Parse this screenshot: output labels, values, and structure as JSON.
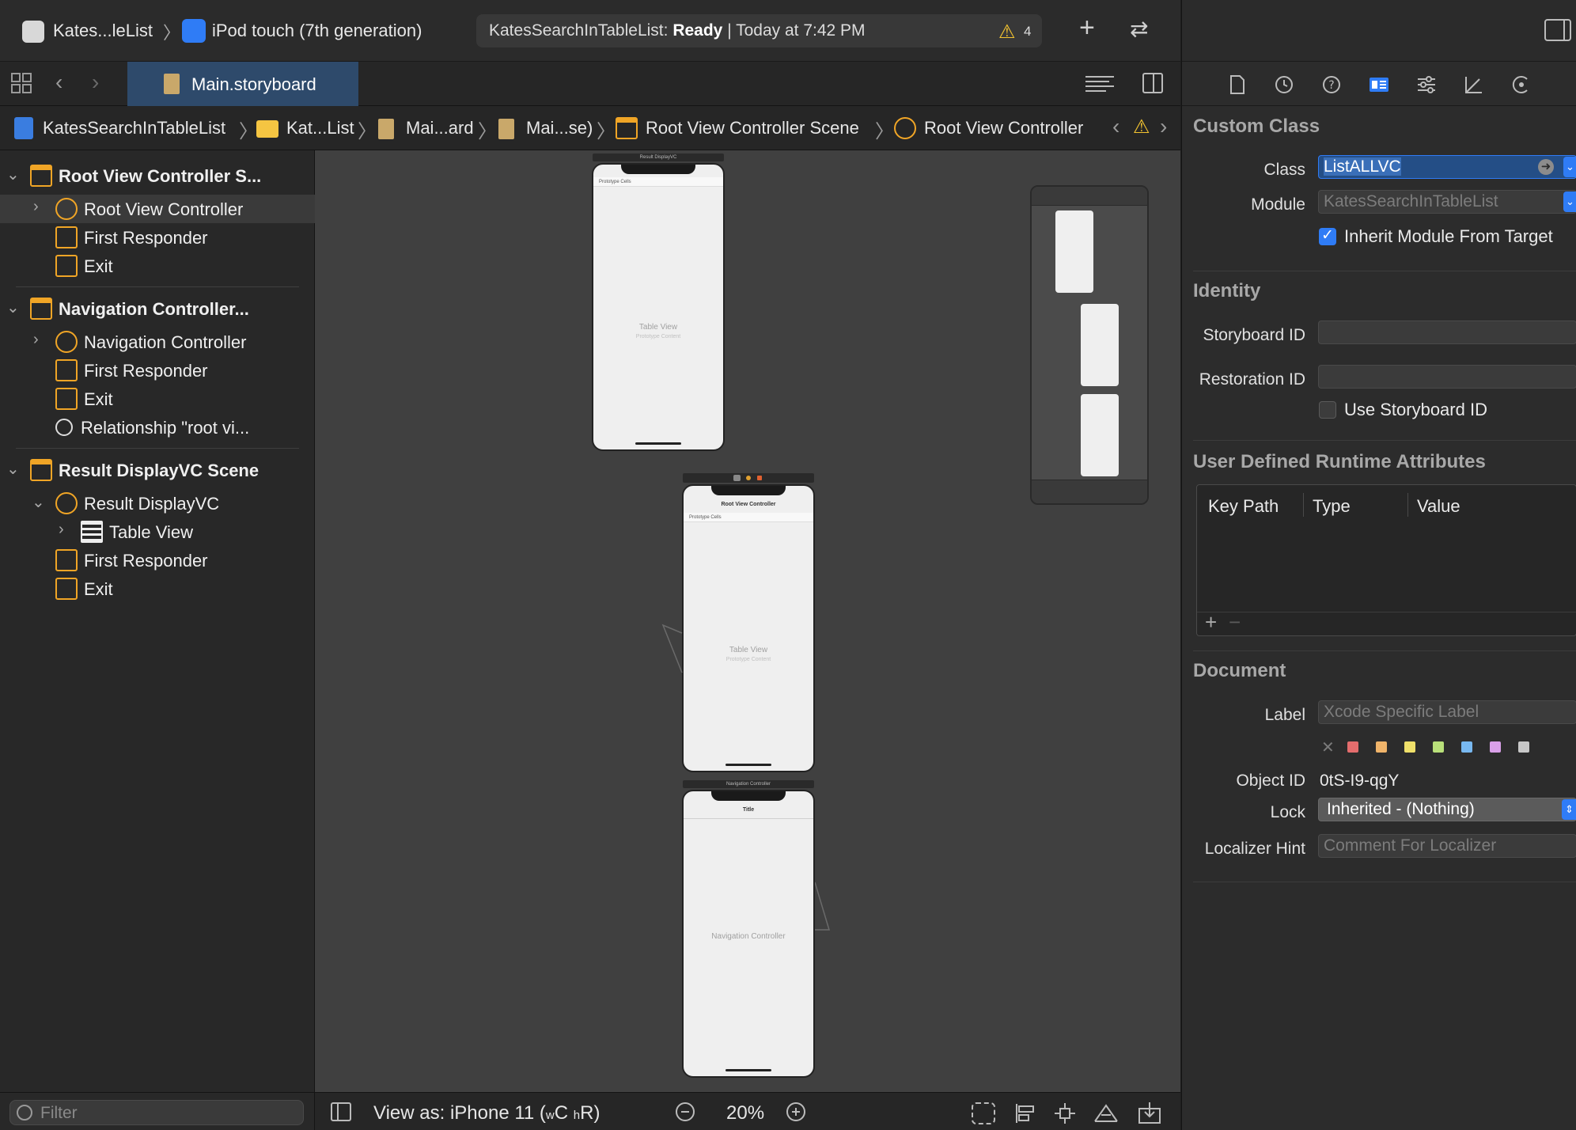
{
  "toolbar": {
    "scheme": "Kates...leList",
    "device": "iPod touch (7th generation)",
    "status_project": "KatesSearchInTableList:",
    "status_state": "Ready",
    "status_time": "| Today at 7:42 PM",
    "warning_count": "4"
  },
  "tabs": {
    "active": "Main.storyboard"
  },
  "jumpbar": {
    "items": [
      "KatesSearchInTableList",
      "Kat...List",
      "Mai...ard",
      "Mai...se)",
      "Root View Controller Scene",
      "Root View Controller"
    ]
  },
  "navigator": {
    "rows": [
      {
        "label": "Root View Controller S...",
        "kind": "scene"
      },
      {
        "label": "Root View Controller",
        "kind": "vc"
      },
      {
        "label": "First Responder",
        "kind": "responder"
      },
      {
        "label": "Exit",
        "kind": "exit"
      },
      {
        "label": "Navigation Controller...",
        "kind": "scene"
      },
      {
        "label": "Navigation Controller",
        "kind": "nav"
      },
      {
        "label": "First Responder",
        "kind": "responder"
      },
      {
        "label": "Exit",
        "kind": "exit"
      },
      {
        "label": "Relationship \"root vi...",
        "kind": "relationship"
      },
      {
        "label": "Result DisplayVC Scene",
        "kind": "scene"
      },
      {
        "label": "Result DisplayVC",
        "kind": "vc"
      },
      {
        "label": "Table View",
        "kind": "table"
      },
      {
        "label": "First Responder",
        "kind": "responder"
      },
      {
        "label": "Exit",
        "kind": "exit"
      }
    ],
    "filter_placeholder": "Filter"
  },
  "canvas": {
    "phone1": {
      "bar": "Result DisplayVC",
      "cells": "Prototype Cells",
      "title": "Table View",
      "subtitle": "Prototype Content"
    },
    "phone2": {
      "nav_title": "Root View Controller",
      "cells": "Prototype Cells",
      "title": "Table View",
      "subtitle": "Prototype Content"
    },
    "phone3": {
      "bar": "Navigation Controller",
      "nav_title": "Title",
      "title": "Navigation Controller"
    },
    "bottom": {
      "view_as": "View as: iPhone 11 (",
      "size_w": "w",
      "size_c": "C",
      "size_h": "h",
      "size_r": "R)",
      "zoom": "20%"
    }
  },
  "inspector": {
    "custom_class": {
      "header": "Custom Class",
      "class_label": "Class",
      "class_value": "ListALLVC",
      "module_label": "Module",
      "module_placeholder": "KatesSearchInTableList",
      "inherit_label": "Inherit Module From Target",
      "inherit_checked": true
    },
    "identity": {
      "header": "Identity",
      "storyboard_id_label": "Storyboard ID",
      "restoration_id_label": "Restoration ID",
      "use_storyboard_label": "Use Storyboard ID",
      "use_storyboard_checked": false
    },
    "runtime": {
      "header": "User Defined Runtime Attributes",
      "columns": [
        "Key Path",
        "Type",
        "Value"
      ]
    },
    "document": {
      "header": "Document",
      "label_label": "Label",
      "label_placeholder": "Xcode Specific Label",
      "object_id_label": "Object ID",
      "object_id_value": "0tS-I9-qgY",
      "lock_label": "Lock",
      "lock_value": "Inherited - (Nothing)",
      "hint_label": "Localizer Hint",
      "hint_placeholder": "Comment For Localizer",
      "swatches": [
        "#e46d6d",
        "#f0b46a",
        "#efe06a",
        "#b9e07a",
        "#78b8f0",
        "#d9a0e8",
        "#c8c8c8"
      ]
    }
  }
}
